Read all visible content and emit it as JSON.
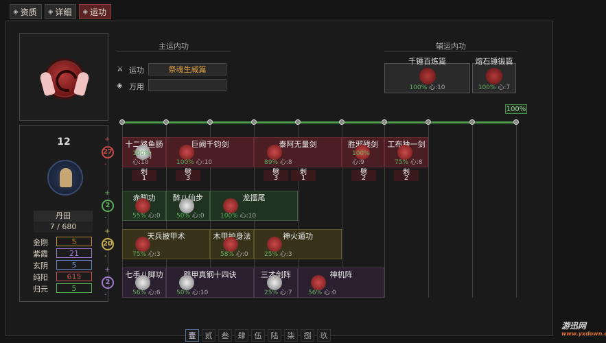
{
  "tabs": [
    {
      "label": "资质",
      "icon": "diamond-icon",
      "active": false
    },
    {
      "label": "详细",
      "icon": "diamond-icon",
      "active": false
    },
    {
      "label": "运功",
      "icon": "diamond-icon",
      "active": true
    }
  ],
  "main_section_title": "主运内功",
  "aux_section_title": "辅运内功",
  "run_label": "运功",
  "run_value": "祭魂生威篇",
  "wanyong_label": "万用",
  "wanyong_value": "",
  "level": "12",
  "dantian_label": "丹田",
  "dantian_value": "7 / 680",
  "attributes": [
    {
      "name": "金刚",
      "value": "5",
      "color": "#c08a2a"
    },
    {
      "name": "紫霞",
      "value": "21",
      "color": "#a07ad0"
    },
    {
      "name": "玄阴",
      "value": "5",
      "color": "#6a8ac8"
    },
    {
      "name": "纯阳",
      "value": "615",
      "color": "#d05050"
    },
    {
      "name": "归元",
      "value": "5",
      "color": "#5ab05a"
    }
  ],
  "aux_cards": [
    {
      "title": "千锤百炼篇",
      "pct": "100%",
      "stat": "心:10"
    },
    {
      "title": "熔石锤锻篇",
      "pct": "100%",
      "stat": "心:7"
    }
  ],
  "aux_pct_badge": "100%",
  "rows": [
    {
      "badge": "27",
      "color": "#c84a4a",
      "cells": [
        {
          "name": "十二路鱼肠刺剑",
          "pct": "100%",
          "stat": "心:10",
          "style": "red",
          "tok": "wh",
          "sub": [
            "刺",
            "1"
          ]
        },
        {
          "name": "巨阙千钧剑",
          "pct": "100%",
          "stat": "心:10",
          "style": "red",
          "tok": "rd",
          "sub": [
            "劈",
            "3"
          ]
        },
        {
          "name": "泰阿无量剑",
          "pct": "89%",
          "stat": "心:8",
          "style": "red",
          "tok": "rd",
          "sub": [
            "劈",
            "3",
            "刺",
            "1"
          ]
        },
        {
          "name": "胜邪残剑",
          "pct": "100%",
          "stat": "心:9",
          "style": "red",
          "tok": "rd",
          "sub": [
            "劈",
            "2"
          ]
        },
        {
          "name": "工布独一剑",
          "pct": "75%",
          "stat": "心:8",
          "style": "red",
          "tok": "rd",
          "sub": [
            "刺",
            "2"
          ]
        }
      ]
    },
    {
      "badge": "2",
      "color": "#5ab05a",
      "cells": [
        {
          "name": "赤脚功",
          "pct": "55%",
          "stat": "心:0",
          "style": "green",
          "tok": "rd"
        },
        {
          "name": "醉八仙步",
          "pct": "50%",
          "stat": "心:0",
          "style": "green",
          "tok": "wh"
        },
        {
          "name": "龙摆尾",
          "pct": "100%",
          "stat": "心:10",
          "style": "green",
          "tok": "rd"
        }
      ]
    },
    {
      "badge": "20",
      "color": "#c8b050",
      "cells": [
        {
          "name": "天兵披甲术",
          "pct": "75%",
          "stat": "心:3",
          "style": "olive",
          "tok": "rd"
        },
        {
          "name": "木甲护身法",
          "pct": "58%",
          "stat": "心:0",
          "style": "olive",
          "tok": "rd"
        },
        {
          "name": "神火遁功",
          "pct": "25%",
          "stat": "心:3",
          "style": "olive",
          "tok": "rd"
        }
      ]
    },
    {
      "badge": "2",
      "color": "#a07ad0",
      "cells": [
        {
          "name": "七手八脚功",
          "pct": "56%",
          "stat": "心:6",
          "style": "purple",
          "tok": "wh"
        },
        {
          "name": "辟甲真钢十四诀",
          "pct": "50%",
          "stat": "心:10",
          "style": "purple",
          "tok": "wh"
        },
        {
          "name": "三才剑阵",
          "pct": "25%",
          "stat": "心:7",
          "style": "purple",
          "tok": "wh"
        },
        {
          "name": "神机阵",
          "pct": "56%",
          "stat": "心:0",
          "style": "purple",
          "tok": "rd"
        }
      ]
    }
  ],
  "bottom_tabs": [
    "壹",
    "贰",
    "叁",
    "肆",
    "伍",
    "陆",
    "柒",
    "捌",
    "玖"
  ],
  "watermark": "游迅网",
  "watermark_url": "www.yxdown.com"
}
